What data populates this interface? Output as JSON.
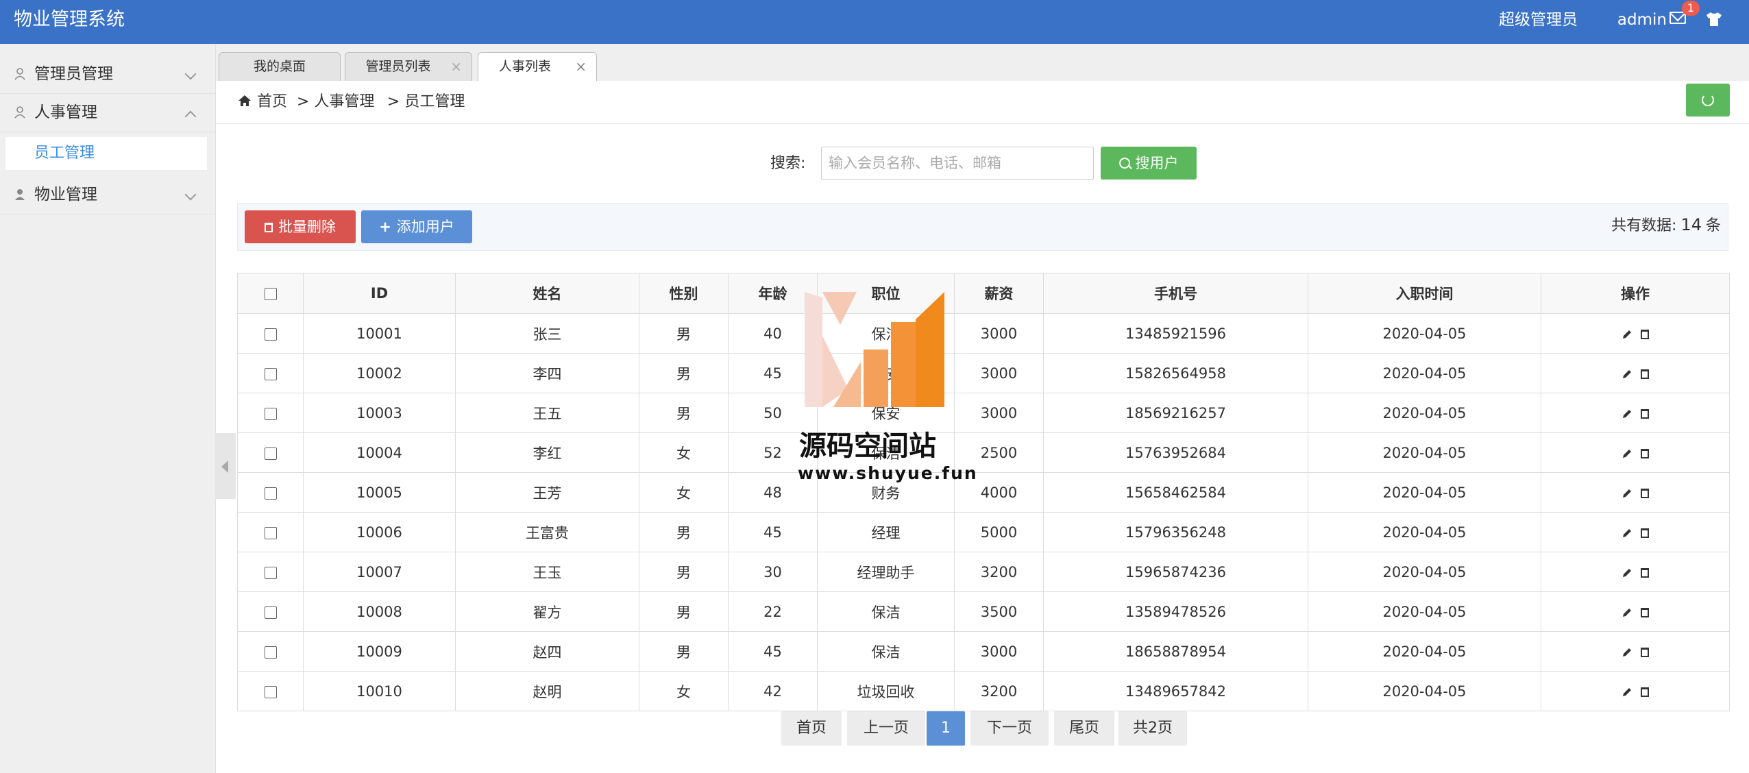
{
  "app": {
    "title": "物业管理系统"
  },
  "header": {
    "role": "超级管理员",
    "user": "admin",
    "mail_badge": "1"
  },
  "sidebar": {
    "items": [
      {
        "label": "管理员管理"
      },
      {
        "label": "人事管理"
      },
      {
        "label": "物业管理"
      }
    ],
    "sub_items": [
      {
        "label": "员工管理"
      }
    ]
  },
  "tabs": [
    {
      "label": "我的桌面"
    },
    {
      "label": "管理员列表",
      "close": "×"
    },
    {
      "label": "人事列表",
      "close": "×"
    }
  ],
  "breadcrumb": {
    "home": "首页",
    "level1": "> 人事管理",
    "level2": "> 员工管理"
  },
  "search": {
    "label": "搜索:",
    "placeholder": "输入会员名称、电话、邮箱",
    "button": "搜用户"
  },
  "toolbar": {
    "delete_label": "批量删除",
    "add_label": "添加用户",
    "count_prefix": "共有数据:",
    "count_value": "14",
    "count_suffix": "条"
  },
  "table": {
    "columns": [
      "ID",
      "姓名",
      "性别",
      "年龄",
      "职位",
      "薪资",
      "手机号",
      "入职时间",
      "操作"
    ],
    "rows": [
      [
        "10001",
        "张三",
        "男",
        "40",
        "保洁",
        "3000",
        "13485921596",
        "2020-04-05"
      ],
      [
        "10002",
        "李四",
        "男",
        "45",
        "保安",
        "3000",
        "15826564958",
        "2020-04-05"
      ],
      [
        "10003",
        "王五",
        "男",
        "50",
        "保安",
        "3000",
        "18569216257",
        "2020-04-05"
      ],
      [
        "10004",
        "李红",
        "女",
        "52",
        "保洁",
        "2500",
        "15763952684",
        "2020-04-05"
      ],
      [
        "10005",
        "王芳",
        "女",
        "48",
        "财务",
        "4000",
        "15658462584",
        "2020-04-05"
      ],
      [
        "10006",
        "王富贵",
        "男",
        "45",
        "经理",
        "5000",
        "15796356248",
        "2020-04-05"
      ],
      [
        "10007",
        "王玉",
        "男",
        "30",
        "经理助手",
        "3200",
        "15965874236",
        "2020-04-05"
      ],
      [
        "10008",
        "翟方",
        "男",
        "22",
        "保洁",
        "3500",
        "13589478526",
        "2020-04-05"
      ],
      [
        "10009",
        "赵四",
        "男",
        "45",
        "保洁",
        "3000",
        "18658878954",
        "2020-04-05"
      ],
      [
        "10010",
        "赵明",
        "女",
        "42",
        "垃圾回收",
        "3200",
        "13489657842",
        "2020-04-05"
      ]
    ]
  },
  "pagination": {
    "first": "首页",
    "prev": "上一页",
    "current": "1",
    "next": "下一页",
    "last": "尾页",
    "total": "共2页"
  },
  "watermark": {
    "title": "源码空间站",
    "url": "www.shuyue.fun"
  },
  "colors": {
    "header": "#3a72c8",
    "success": "#5cb85c",
    "danger": "#d9534f",
    "primary": "#5b8fd6",
    "link": "#3a8ee6"
  }
}
